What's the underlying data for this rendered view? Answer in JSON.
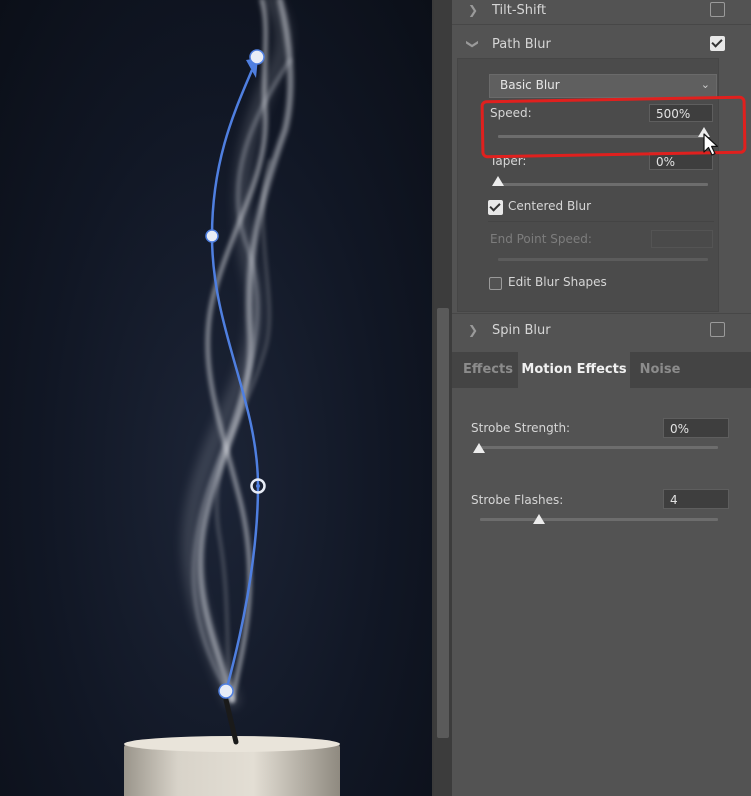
{
  "panel": {
    "sections": {
      "tilt_shift": {
        "label": "Tilt-Shift",
        "enabled": false
      },
      "path_blur": {
        "label": "Path Blur",
        "enabled": true
      },
      "spin_blur": {
        "label": "Spin Blur",
        "enabled": false
      }
    },
    "path_blur": {
      "blur_type": "Basic Blur",
      "speed": {
        "label": "Speed:",
        "value": "500%",
        "level_pct": 100
      },
      "taper": {
        "label": "Taper:",
        "value": "0%",
        "level_pct": 0
      },
      "centered_blur": {
        "label": "Centered Blur",
        "checked": true
      },
      "end_point_speed": {
        "label": "End Point Speed:",
        "value": "",
        "disabled": true
      },
      "edit_blur_shapes": {
        "label": "Edit Blur Shapes",
        "checked": false
      }
    },
    "tabs": [
      {
        "label": "Effects",
        "active": false
      },
      {
        "label": "Motion Effects",
        "active": true
      },
      {
        "label": "Noise",
        "active": false
      }
    ],
    "motion_effects": {
      "strobe_strength": {
        "label": "Strobe Strength:",
        "value": "0%",
        "level_pct": 0
      },
      "strobe_flashes": {
        "label": "Strobe Flashes:",
        "value": "4",
        "level_pct": 25
      }
    }
  },
  "colors": {
    "path_line": "#4f7fe0",
    "highlight": "#e0201e",
    "panel_bg": "#535353"
  }
}
